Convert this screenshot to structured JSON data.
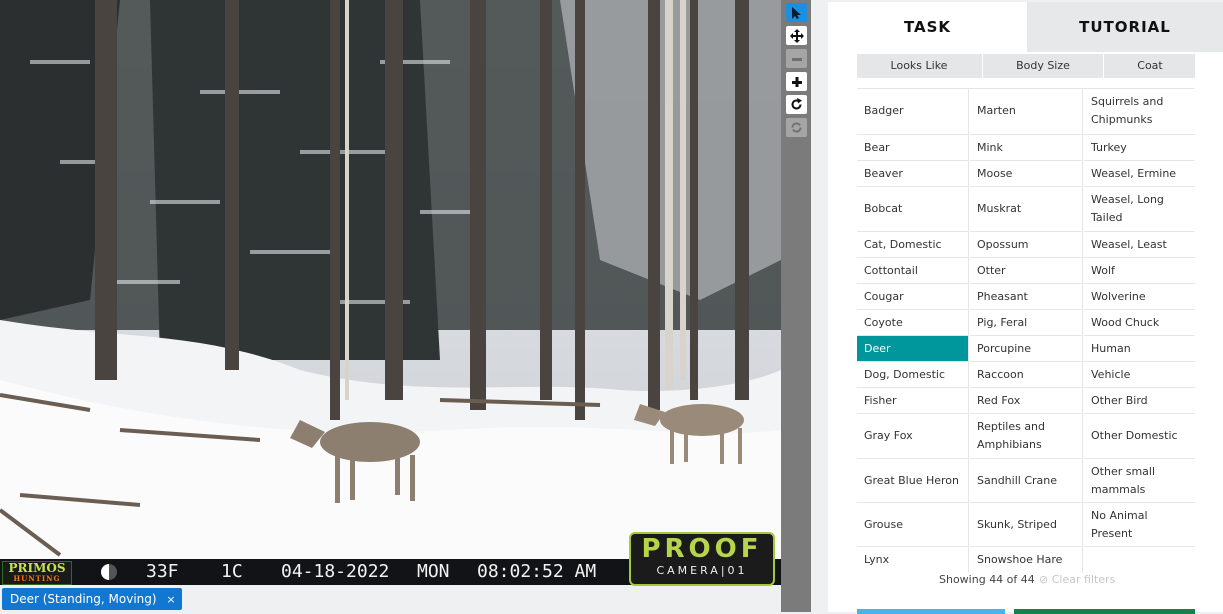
{
  "camera": {
    "brand_top": "PRIMOS",
    "brand_bottom": "HUNTING",
    "temp_f": "33F",
    "temp_c": "1C",
    "date": "04-18-2022",
    "day": "MON",
    "time": "08:02:52 AM",
    "logo_word": "PROOF",
    "logo_sub": "CAMERA|01"
  },
  "annotation_tag": {
    "label": "Deer (Standing, Moving)",
    "remove": "×"
  },
  "tools": [
    {
      "name": "pointer",
      "icon": "arrow-icon",
      "state": "active"
    },
    {
      "name": "pan",
      "icon": "move-icon",
      "state": "normal"
    },
    {
      "name": "zoom-out",
      "icon": "minus-icon",
      "state": "normal"
    },
    {
      "name": "zoom-in",
      "icon": "plus-icon",
      "state": "normal"
    },
    {
      "name": "rotate",
      "icon": "rotate-icon",
      "state": "normal"
    },
    {
      "name": "reset",
      "icon": "reset-icon",
      "state": "disabled"
    }
  ],
  "tabs": {
    "task": "TASK",
    "tutorial": "TUTORIAL"
  },
  "filters": [
    "Looks Like",
    "Body Size",
    "Coat"
  ],
  "species_rows": [
    [
      "Badger",
      "Marten",
      "Squirrels and Chipmunks"
    ],
    [
      "Bear",
      "Mink",
      "Turkey"
    ],
    [
      "Beaver",
      "Moose",
      "Weasel, Ermine"
    ],
    [
      "Bobcat",
      "Muskrat",
      "Weasel, Long Tailed"
    ],
    [
      "Cat, Domestic",
      "Opossum",
      "Weasel, Least"
    ],
    [
      "Cottontail",
      "Otter",
      "Wolf"
    ],
    [
      "Cougar",
      "Pheasant",
      "Wolverine"
    ],
    [
      "Coyote",
      "Pig, Feral",
      "Wood Chuck"
    ],
    [
      "Deer",
      "Porcupine",
      "Human"
    ],
    [
      "Dog, Domestic",
      "Raccoon",
      "Vehicle"
    ],
    [
      "Fisher",
      "Red Fox",
      "Other Bird"
    ],
    [
      "Gray Fox",
      "Reptiles and Amphibians",
      "Other Domestic"
    ],
    [
      "Great Blue Heron",
      "Sandhill Crane",
      "Other small mammals"
    ],
    [
      "Grouse",
      "Skunk, Striped",
      "No Animal Present"
    ],
    [
      "Lynx",
      "Snowshoe Hare",
      ""
    ]
  ],
  "selected_species": "Deer",
  "status": {
    "showing": "Showing 44 of 44",
    "clear": "Clear filters"
  },
  "colors": {
    "selected": "#00979c",
    "tag": "#1177d0",
    "tool_active": "#1b8fe0"
  }
}
